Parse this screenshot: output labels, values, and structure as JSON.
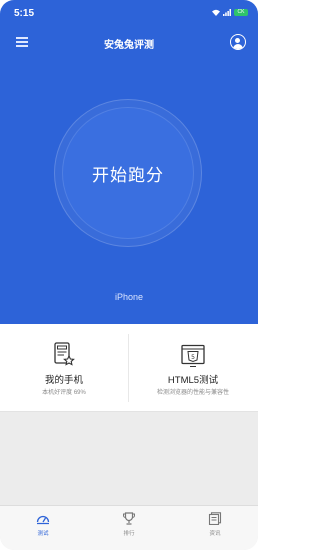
{
  "status_bar": {
    "time": "5:15",
    "battery": "CK"
  },
  "header": {
    "title": "安兔兔评测"
  },
  "hero": {
    "start_label": "开始跑分",
    "device_name": "iPhone"
  },
  "cards": [
    {
      "title": "我的手机",
      "subtitle": "本机好评度 69%"
    },
    {
      "title": "HTML5测试",
      "subtitle": "检测浏览器的性能与兼容性"
    }
  ],
  "tabs": [
    {
      "label": "测试",
      "active": true
    },
    {
      "label": "排行",
      "active": false
    },
    {
      "label": "资讯",
      "active": false
    }
  ],
  "colors": {
    "accent": "#2d63d8",
    "background": "#ececec",
    "battery": "#2ec46b"
  }
}
